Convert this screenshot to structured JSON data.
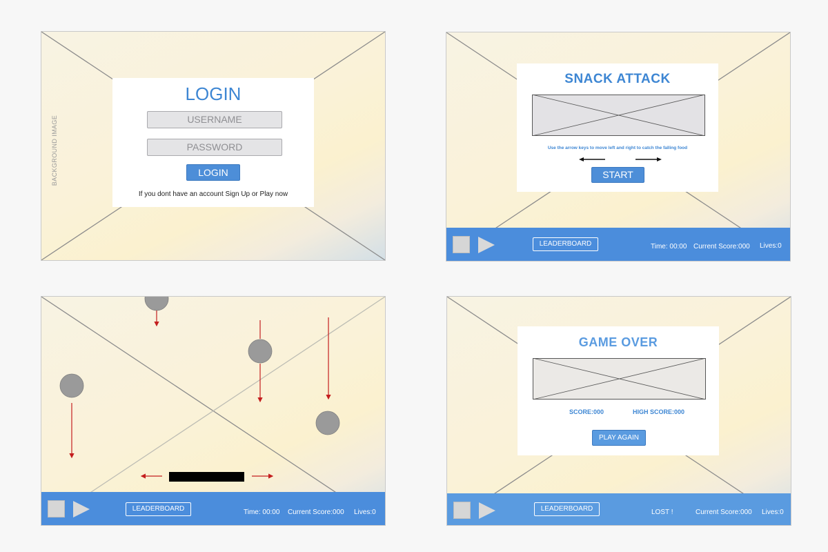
{
  "login": {
    "bg_label": "BACKGROUND IMAGE",
    "title": "LOGIN",
    "username_placeholder": "USERNAME",
    "password_placeholder": "PASSWORD",
    "button": "LOGIN",
    "footer": "If you dont have an account Sign Up or Play now"
  },
  "start_screen": {
    "title": "SNACK ATTACK",
    "instructions": "Use the arrow keys to move left and right to catch the falling food",
    "button": "START"
  },
  "game_over": {
    "title": "GAME OVER",
    "score": "SCORE:000",
    "high_score": "HIGH SCORE:000",
    "button": "PLAY AGAIN"
  },
  "hud": {
    "leaderboard": "LEADERBOARD",
    "time": "Time: 00:00",
    "current_score": "Current Score:000",
    "lives": "Lives:0",
    "lost": "LOST !",
    "stop_icon": "stop-icon",
    "play_icon": "play-icon"
  },
  "colors": {
    "accent": "#4b8ddc",
    "title_blue": "#3d86d3",
    "arrow_red": "#c41e1e",
    "food_gray": "#9a9a9a"
  }
}
